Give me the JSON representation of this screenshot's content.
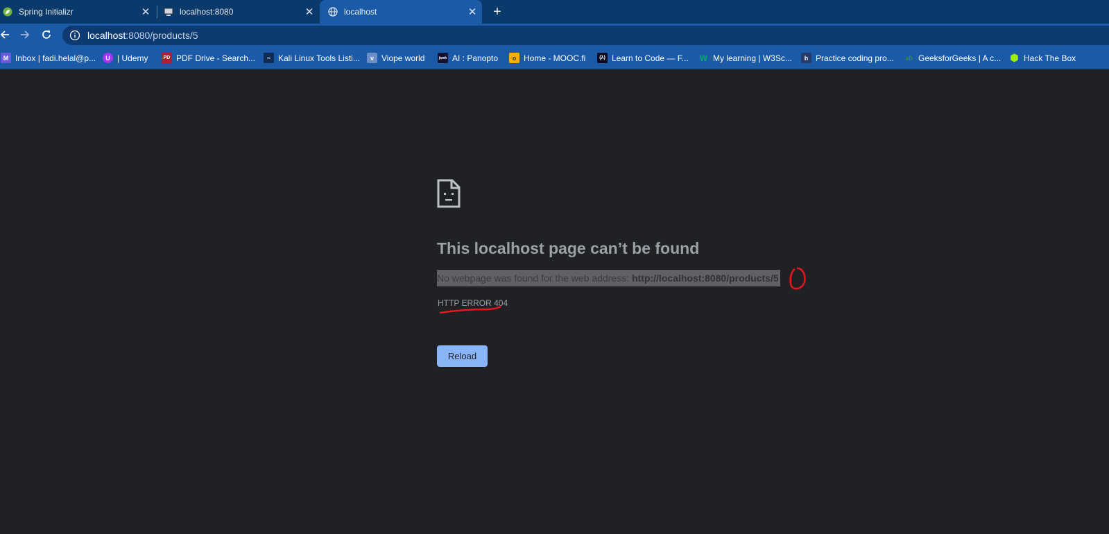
{
  "tabs": [
    {
      "title": "Spring Initializr",
      "icon": "spring-leaf-icon"
    },
    {
      "title": "localhost:8080",
      "icon": "monitor-icon"
    },
    {
      "title": "localhost",
      "icon": "globe-icon",
      "active": true
    }
  ],
  "toolbar": {
    "url_host": "localhost",
    "url_rest": ":8080/products/5"
  },
  "bookmarks": [
    {
      "label": "Inbox | fadi.helal@p...",
      "icon": "mail-icon",
      "glyph": "M",
      "color": "#6a5cd8"
    },
    {
      "label": "| Udemy",
      "icon": "udemy-icon",
      "glyph": "U",
      "color": "#a435f0"
    },
    {
      "label": "PDF Drive - Search...",
      "icon": "pdf-icon",
      "glyph": "PD",
      "color": "#b0202a"
    },
    {
      "label": "Kali Linux Tools Listi...",
      "icon": "kali-dragon-icon",
      "glyph": "~",
      "color": "#1a5aa6"
    },
    {
      "label": "Viope world",
      "icon": "viope-icon",
      "glyph": "v",
      "color": "#6c8fc7"
    },
    {
      "label": "AI : Panopto",
      "icon": "panopto-icon",
      "glyph": "jamk",
      "color": "#111133"
    },
    {
      "label": "Home - MOOC.fi",
      "icon": "mooc-icon",
      "glyph": "o",
      "color": "#f0b400"
    },
    {
      "label": "Learn to Code — F...",
      "icon": "freecodecamp-icon",
      "glyph": "(λ)",
      "color": "#0a0a23"
    },
    {
      "label": "My learning | W3Sc...",
      "icon": "w3schools-icon",
      "glyph": "W",
      "color": "#1a5aa6"
    },
    {
      "label": "Practice coding pro...",
      "icon": "hackerrank-icon",
      "glyph": "h",
      "color": "#243b6b"
    },
    {
      "label": "GeeksforGeeks | A c...",
      "icon": "geeksforgeeks-icon",
      "glyph": "ǝƃ",
      "color": "#1a5aa6"
    },
    {
      "label": "Hack The Box",
      "icon": "hackthebox-icon",
      "glyph": "⬢",
      "color": "#1a5aa6"
    }
  ],
  "error": {
    "title": "This localhost page can’t be found",
    "desc_prefix": "No webpage was found for the web address:",
    "desc_url": "http://localhost:8080/products/5",
    "code": "HTTP ERROR 404",
    "reload_label": "Reload"
  },
  "colors": {
    "tabstrip": "#0a3a6b",
    "toolbar": "#1a5aa6",
    "page_bg": "#202124",
    "reload_button": "#8ab4f8",
    "annotation": "#e8171d"
  }
}
